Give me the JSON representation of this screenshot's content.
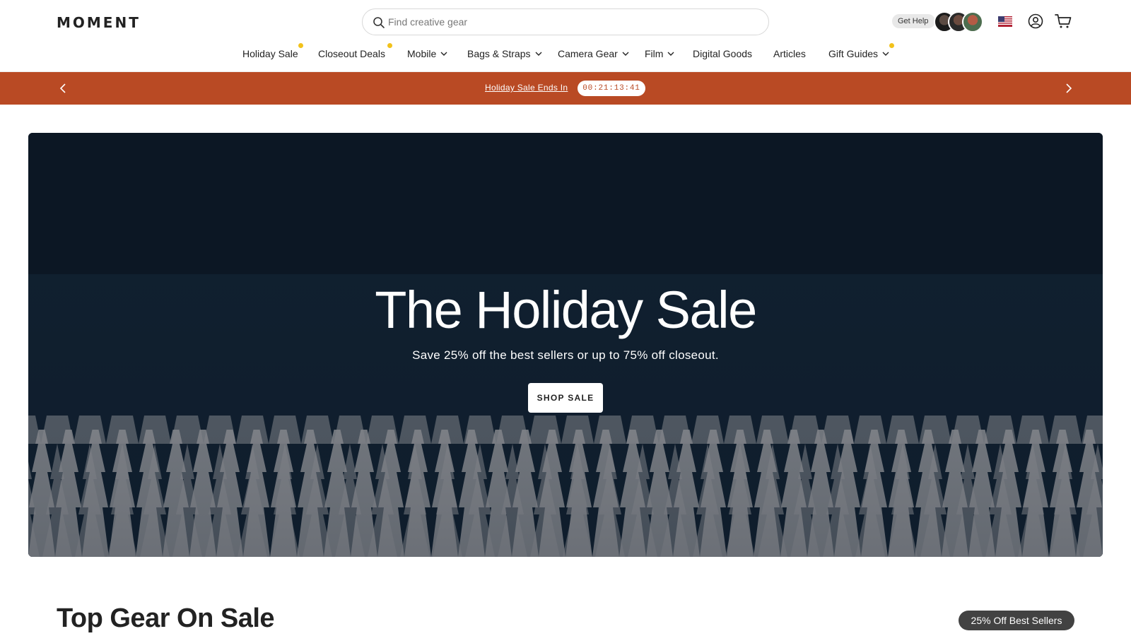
{
  "brand": {
    "logo_text": "MOMENT"
  },
  "search": {
    "placeholder": "Find creative gear",
    "value": ""
  },
  "header": {
    "get_help_label": "Get Help",
    "avatars": [
      "support-agent-1",
      "support-agent-2",
      "support-agent-3"
    ],
    "flag_icon": "us-flag-icon",
    "account_icon": "user-icon",
    "cart_icon": "cart-icon"
  },
  "nav": {
    "items": [
      {
        "label": "Holiday Sale",
        "has_dropdown": false,
        "badge_dot": true
      },
      {
        "label": "Closeout Deals",
        "has_dropdown": false,
        "badge_dot": true
      },
      {
        "label": "Mobile",
        "has_dropdown": true,
        "badge_dot": false
      },
      {
        "label": "Bags & Straps",
        "has_dropdown": true,
        "badge_dot": false
      },
      {
        "label": "Camera Gear",
        "has_dropdown": true,
        "badge_dot": false
      },
      {
        "label": "Film",
        "has_dropdown": true,
        "badge_dot": false
      },
      {
        "label": "Digital Goods",
        "has_dropdown": false,
        "badge_dot": false
      },
      {
        "label": "Articles",
        "has_dropdown": false,
        "badge_dot": false
      },
      {
        "label": "Gift Guides",
        "has_dropdown": true,
        "badge_dot": true
      }
    ]
  },
  "banner": {
    "link_text": "Holiday Sale Ends In",
    "countdown": "00:21:13:41",
    "color": "#b94a24"
  },
  "hero": {
    "title": "The Holiday Sale",
    "subtitle": "Save 25% off the best sellers or up to 75% off closeout.",
    "cta_label": "SHOP SALE"
  },
  "section": {
    "title": "Top Gear On Sale",
    "badge": "25% Off Best Sellers"
  },
  "colors": {
    "accent": "#b94a24",
    "dot": "#f2c21b",
    "badge_bg": "#424242"
  }
}
